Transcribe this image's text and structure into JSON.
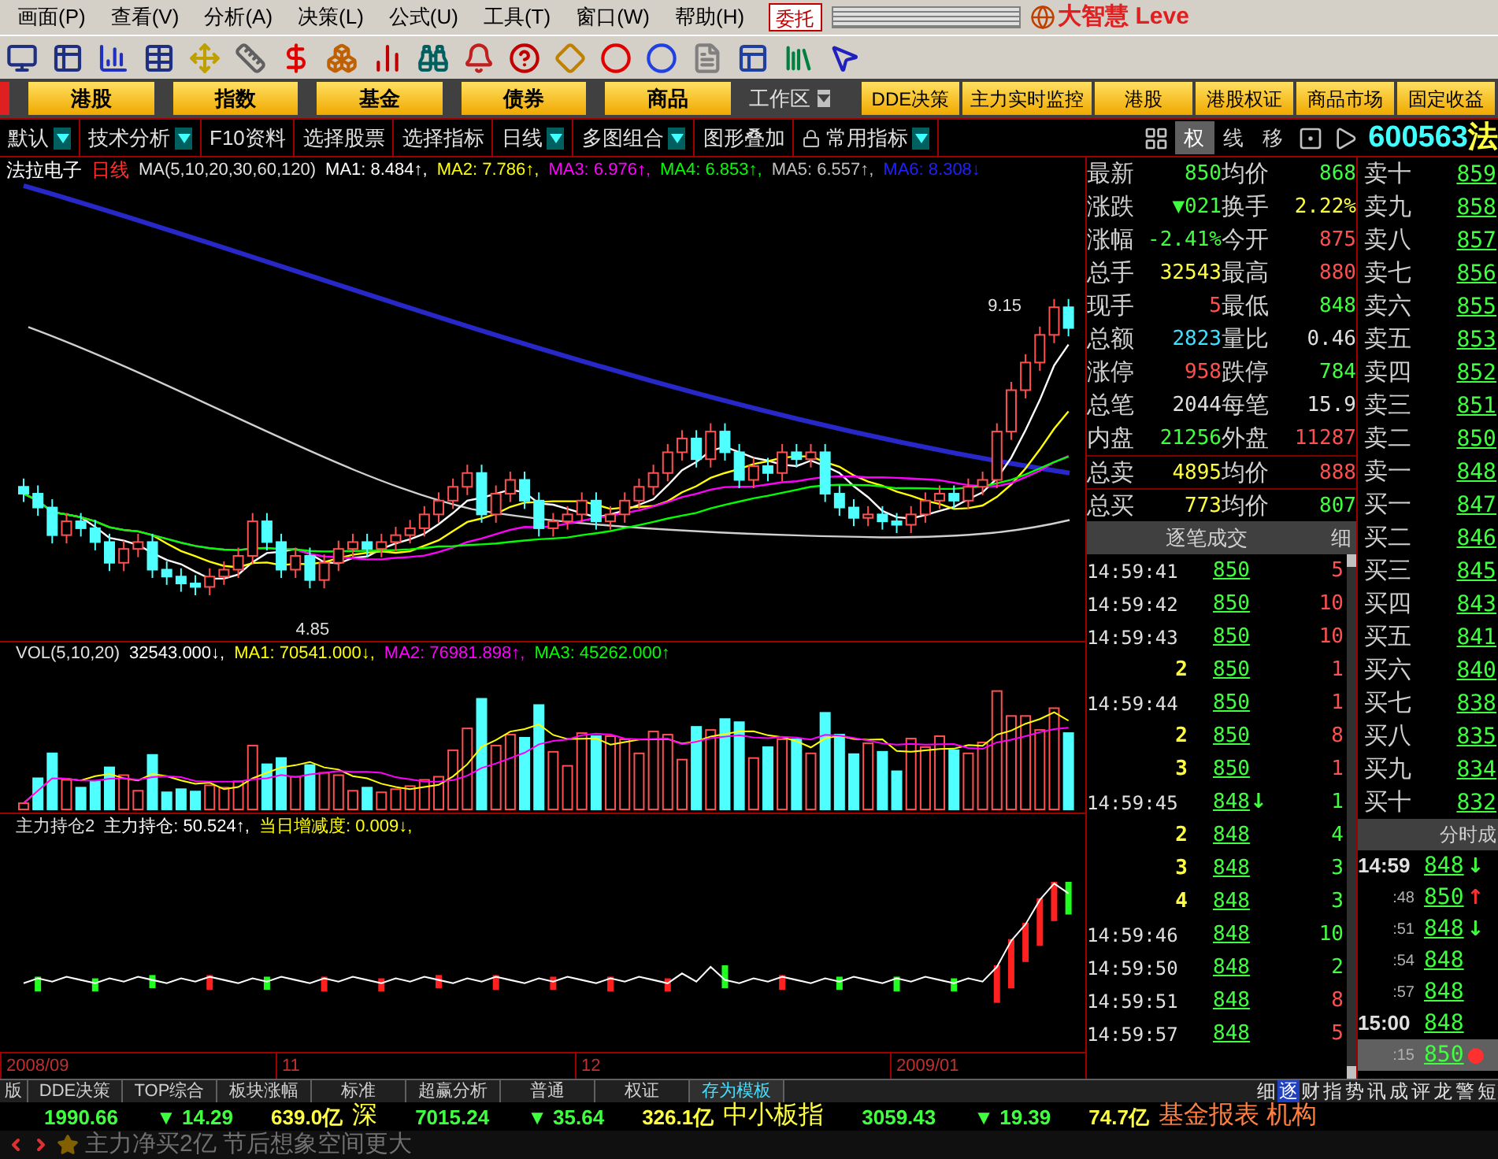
{
  "menu_bar": {
    "items": [
      "画面(P)",
      "查看(V)",
      "分析(A)",
      "决策(L)",
      "公式(U)",
      "工具(T)",
      "窗口(W)",
      "帮助(H)"
    ],
    "order_button": "委托",
    "brand": "大智慧 Leve"
  },
  "category_buttons": [
    "港股",
    "指数",
    "基金",
    "债券",
    "商品"
  ],
  "workspace": "工作区",
  "panel_buttons": [
    "DDE决策",
    "主力实时监控",
    "港股",
    "港股权证",
    "商品市场",
    "固定收益"
  ],
  "analysis_toolbar": [
    {
      "label": "默认",
      "dropdown": true
    },
    {
      "label": "技术分析",
      "dropdown": true
    },
    {
      "label": "F10资料",
      "dropdown": false
    },
    {
      "label": "选择股票",
      "dropdown": false
    },
    {
      "label": "选择指标",
      "dropdown": false
    },
    {
      "label": "日线",
      "dropdown": true
    },
    {
      "label": "多图组合",
      "dropdown": true
    },
    {
      "label": "图形叠加",
      "dropdown": false
    },
    {
      "label": "常用指标",
      "dropdown": true
    }
  ],
  "view_buttons": [
    {
      "label": "权",
      "selected": true
    },
    {
      "label": "线",
      "selected": false
    },
    {
      "label": "移",
      "selected": false
    }
  ],
  "stock_code": "600563",
  "stock_name_cut": "法",
  "price_chart": {
    "stock_name": "法拉电子",
    "period": "日线",
    "ma_params": "MA(5,10,20,30,60,120)",
    "ma_values": [
      {
        "label": "MA1: 8.484↑,",
        "color": "#ffffff"
      },
      {
        "label": "MA2: 7.786↑,",
        "color": "#ffff00"
      },
      {
        "label": "MA3: 6.976↑,",
        "color": "#ff00ff"
      },
      {
        "label": "MA4: 6.853↑,",
        "color": "#00ff00"
      },
      {
        "label": "MA5: 6.557↑,",
        "color": "#c0c0c0"
      },
      {
        "label": "MA6: 8.308↓",
        "color": "#2020ff"
      }
    ],
    "high_label": "9.15",
    "low_label": "4.85"
  },
  "volume_chart": {
    "title": "VOL(5,10,20)",
    "values": [
      {
        "label": "32543.000↓,",
        "color": "#ffffff"
      },
      {
        "label": "MA1: 70541.000↓,",
        "color": "#ffff00"
      },
      {
        "label": "MA2: 76981.898↑,",
        "color": "#ff00ff"
      },
      {
        "label": "MA3: 45262.000↑",
        "color": "#00ff00"
      }
    ]
  },
  "indicator_chart": {
    "name": "主力持仓2",
    "values": [
      {
        "label": "主力持仓: 50.524↑,",
        "color": "#ffffff"
      },
      {
        "label": "当日增减度: 0.009↓,",
        "color": "#ffff00"
      }
    ]
  },
  "date_axis": [
    "2008/09",
    "11",
    "12",
    "2009/01"
  ],
  "quote": [
    {
      "cells": [
        {
          "label": "最新",
          "value": "850",
          "color": "#40ff40"
        },
        {
          "label": "均价",
          "value": "868",
          "color": "#40ff40"
        }
      ]
    },
    {
      "cells": [
        {
          "label": "涨跌",
          "value": "▼021",
          "color": "#40ff40"
        },
        {
          "label": "换手",
          "value": "2.22%",
          "color": "#ffff40"
        }
      ]
    },
    {
      "cells": [
        {
          "label": "涨幅",
          "value": "-2.41%",
          "color": "#40ff40"
        },
        {
          "label": "今开",
          "value": "875",
          "color": "#ff5050"
        }
      ]
    },
    {
      "cells": [
        {
          "label": "总手",
          "value": "32543",
          "color": "#ffff40"
        },
        {
          "label": "最高",
          "value": "880",
          "color": "#ff5050"
        }
      ]
    },
    {
      "cells": [
        {
          "label": "现手",
          "value": "5",
          "color": "#ff5050"
        },
        {
          "label": "最低",
          "value": "848",
          "color": "#40ff40"
        }
      ]
    },
    {
      "cells": [
        {
          "label": "总额",
          "value": "2823",
          "color": "#40e0ff"
        },
        {
          "label": "量比",
          "value": "0.46",
          "color": "#e0e0e0"
        }
      ]
    },
    {
      "cells": [
        {
          "label": "涨停",
          "value": "958",
          "color": "#ff5050"
        },
        {
          "label": "跌停",
          "value": "784",
          "color": "#40ff40"
        }
      ]
    },
    {
      "cells": [
        {
          "label": "总笔",
          "value": "2044",
          "color": "#e0e0e0"
        },
        {
          "label": "每笔",
          "value": "15.9",
          "color": "#e0e0e0"
        }
      ]
    },
    {
      "cells": [
        {
          "label": "内盘",
          "value": "21256",
          "color": "#40ff40"
        },
        {
          "label": "外盘",
          "value": "11287",
          "color": "#ff5050"
        }
      ]
    },
    {
      "cells": [
        {
          "label": "总卖",
          "value": "4895",
          "color": "#ffff40"
        },
        {
          "label": "均价",
          "value": "888",
          "color": "#ff5050"
        }
      ]
    },
    {
      "cells": [
        {
          "label": "总买",
          "value": "773",
          "color": "#ffff40"
        },
        {
          "label": "均价",
          "value": "807",
          "color": "#40ff40"
        }
      ]
    }
  ],
  "order_book": [
    {
      "label": "卖十",
      "price": "859"
    },
    {
      "label": "卖九",
      "price": "858"
    },
    {
      "label": "卖八",
      "price": "857"
    },
    {
      "label": "卖七",
      "price": "856"
    },
    {
      "label": "卖六",
      "price": "855"
    },
    {
      "label": "卖五",
      "price": "853"
    },
    {
      "label": "卖四",
      "price": "852"
    },
    {
      "label": "卖三",
      "price": "851"
    },
    {
      "label": "卖二",
      "price": "850"
    },
    {
      "label": "卖一",
      "price": "848"
    },
    {
      "label": "买一",
      "price": "847"
    },
    {
      "label": "买二",
      "price": "846"
    },
    {
      "label": "买三",
      "price": "845"
    },
    {
      "label": "买四",
      "price": "843"
    },
    {
      "label": "买五",
      "price": "841"
    },
    {
      "label": "买六",
      "price": "840"
    },
    {
      "label": "买七",
      "price": "838"
    },
    {
      "label": "买八",
      "price": "835"
    },
    {
      "label": "买九",
      "price": "834"
    },
    {
      "label": "买十",
      "price": "832"
    }
  ],
  "ticks": {
    "title": "逐笔成交",
    "toggle": "细",
    "rows": [
      {
        "time": "14:59:41",
        "kind": "full",
        "price": "850",
        "volume": "5",
        "color": "#ff5050"
      },
      {
        "time": "14:59:42",
        "kind": "full",
        "price": "850",
        "volume": "10",
        "color": "#ff5050"
      },
      {
        "time": "14:59:43",
        "kind": "full",
        "price": "850",
        "volume": "10",
        "color": "#ff5050"
      },
      {
        "time": "2",
        "kind": "sub",
        "price": "850",
        "volume": "1",
        "color": "#ff5050"
      },
      {
        "time": "14:59:44",
        "kind": "full",
        "price": "850",
        "volume": "1",
        "color": "#ff5050"
      },
      {
        "time": "2",
        "kind": "sub",
        "price": "850",
        "volume": "8",
        "color": "#ff5050"
      },
      {
        "time": "3",
        "kind": "sub",
        "price": "850",
        "volume": "1",
        "color": "#ff5050"
      },
      {
        "time": "14:59:45",
        "kind": "full",
        "price": "848",
        "arrow": {
          "text": "↓",
          "color": "#40ff40"
        },
        "volume": "1",
        "color": "#40ff40"
      },
      {
        "time": "2",
        "kind": "sub",
        "price": "848",
        "volume": "4",
        "color": "#40ff40"
      },
      {
        "time": "3",
        "kind": "sub",
        "price": "848",
        "volume": "3",
        "color": "#40ff40"
      },
      {
        "time": "4",
        "kind": "sub",
        "price": "848",
        "volume": "3",
        "color": "#40ff40"
      },
      {
        "time": "14:59:46",
        "kind": "full",
        "price": "848",
        "volume": "10",
        "color": "#40ff40"
      },
      {
        "time": "14:59:50",
        "kind": "full",
        "price": "848",
        "volume": "2",
        "color": "#40ff40"
      },
      {
        "time": "14:59:51",
        "kind": "full",
        "price": "848",
        "volume": "8",
        "color": "#ff5050"
      },
      {
        "time": "14:59:57",
        "kind": "full",
        "price": "848",
        "volume": "5",
        "color": "#ff5050"
      }
    ]
  },
  "minute_trades": {
    "title": "分时成",
    "rows": [
      {
        "time": "14:59",
        "kind": "full",
        "price": "848",
        "arrow": {
          "text": "↓",
          "color": "#40ff40"
        },
        "selected": false
      },
      {
        "time": ":48",
        "kind": "sub",
        "price": "850",
        "arrow": {
          "text": "↑",
          "color": "#ff3030"
        },
        "selected": false
      },
      {
        "time": ":51",
        "kind": "sub",
        "price": "848",
        "arrow": {
          "text": "↓",
          "color": "#40ff40"
        },
        "selected": false
      },
      {
        "time": ":54",
        "kind": "sub",
        "price": "848",
        "selected": false
      },
      {
        "time": ":57",
        "kind": "sub",
        "price": "848",
        "selected": false
      },
      {
        "time": "15:00",
        "kind": "full",
        "price": "848",
        "selected": false
      },
      {
        "time": ":15",
        "kind": "sub",
        "price": "850",
        "arrow": {
          "text": "●",
          "color": "#ff3030"
        },
        "selected": true
      }
    ]
  },
  "bottom_tabs": [
    {
      "label": "版",
      "selected": false
    },
    {
      "label": "DDE决策",
      "selected": false
    },
    {
      "label": "TOP综合",
      "selected": false
    },
    {
      "label": "板块涨幅",
      "selected": false
    },
    {
      "label": "标准",
      "selected": false
    },
    {
      "label": "超赢分析",
      "selected": false
    },
    {
      "label": "普通",
      "selected": false
    },
    {
      "label": "权证",
      "selected": false
    },
    {
      "label": "存为模板",
      "selected": true
    }
  ],
  "side_tabs": [
    {
      "label": "细",
      "selected": false
    },
    {
      "label": "逐",
      "selected": true
    },
    {
      "label": "财",
      "selected": false
    },
    {
      "label": "指",
      "selected": false
    },
    {
      "label": "势",
      "selected": false
    },
    {
      "label": "讯",
      "selected": false
    },
    {
      "label": "成",
      "selected": false
    },
    {
      "label": "评",
      "selected": false
    },
    {
      "label": "龙",
      "selected": false
    },
    {
      "label": "警",
      "selected": false
    },
    {
      "label": "短",
      "selected": false
    }
  ],
  "index_bar": [
    {
      "text": "1990.66",
      "color": "#40ff40",
      "kind": "number"
    },
    {
      "text": "▼ 14.29",
      "color": "#40ff40",
      "kind": "number"
    },
    {
      "text": "639.0亿",
      "color": "#ffff40",
      "kind": "number"
    },
    {
      "text": "深",
      "color": "#ffff40",
      "kind": "name"
    },
    {
      "text": "7015.24",
      "color": "#40ff40",
      "kind": "number"
    },
    {
      "text": "▼ 35.64",
      "color": "#40ff40",
      "kind": "number"
    },
    {
      "text": "326.1亿",
      "color": "#ffff40",
      "kind": "number"
    },
    {
      "text": "中小板指",
      "color": "#ffff40",
      "kind": "name"
    },
    {
      "text": "3059.43",
      "color": "#40ff40",
      "kind": "number"
    },
    {
      "text": "▼ 19.39",
      "color": "#40ff40",
      "kind": "number"
    },
    {
      "text": "74.7亿",
      "color": "#ffff40",
      "kind": "number"
    },
    {
      "text": "基金报表 机构",
      "color": "#ff8040",
      "kind": "name"
    }
  ],
  "news_ticker": "主力净买2亿 节后想象空间更大"
}
